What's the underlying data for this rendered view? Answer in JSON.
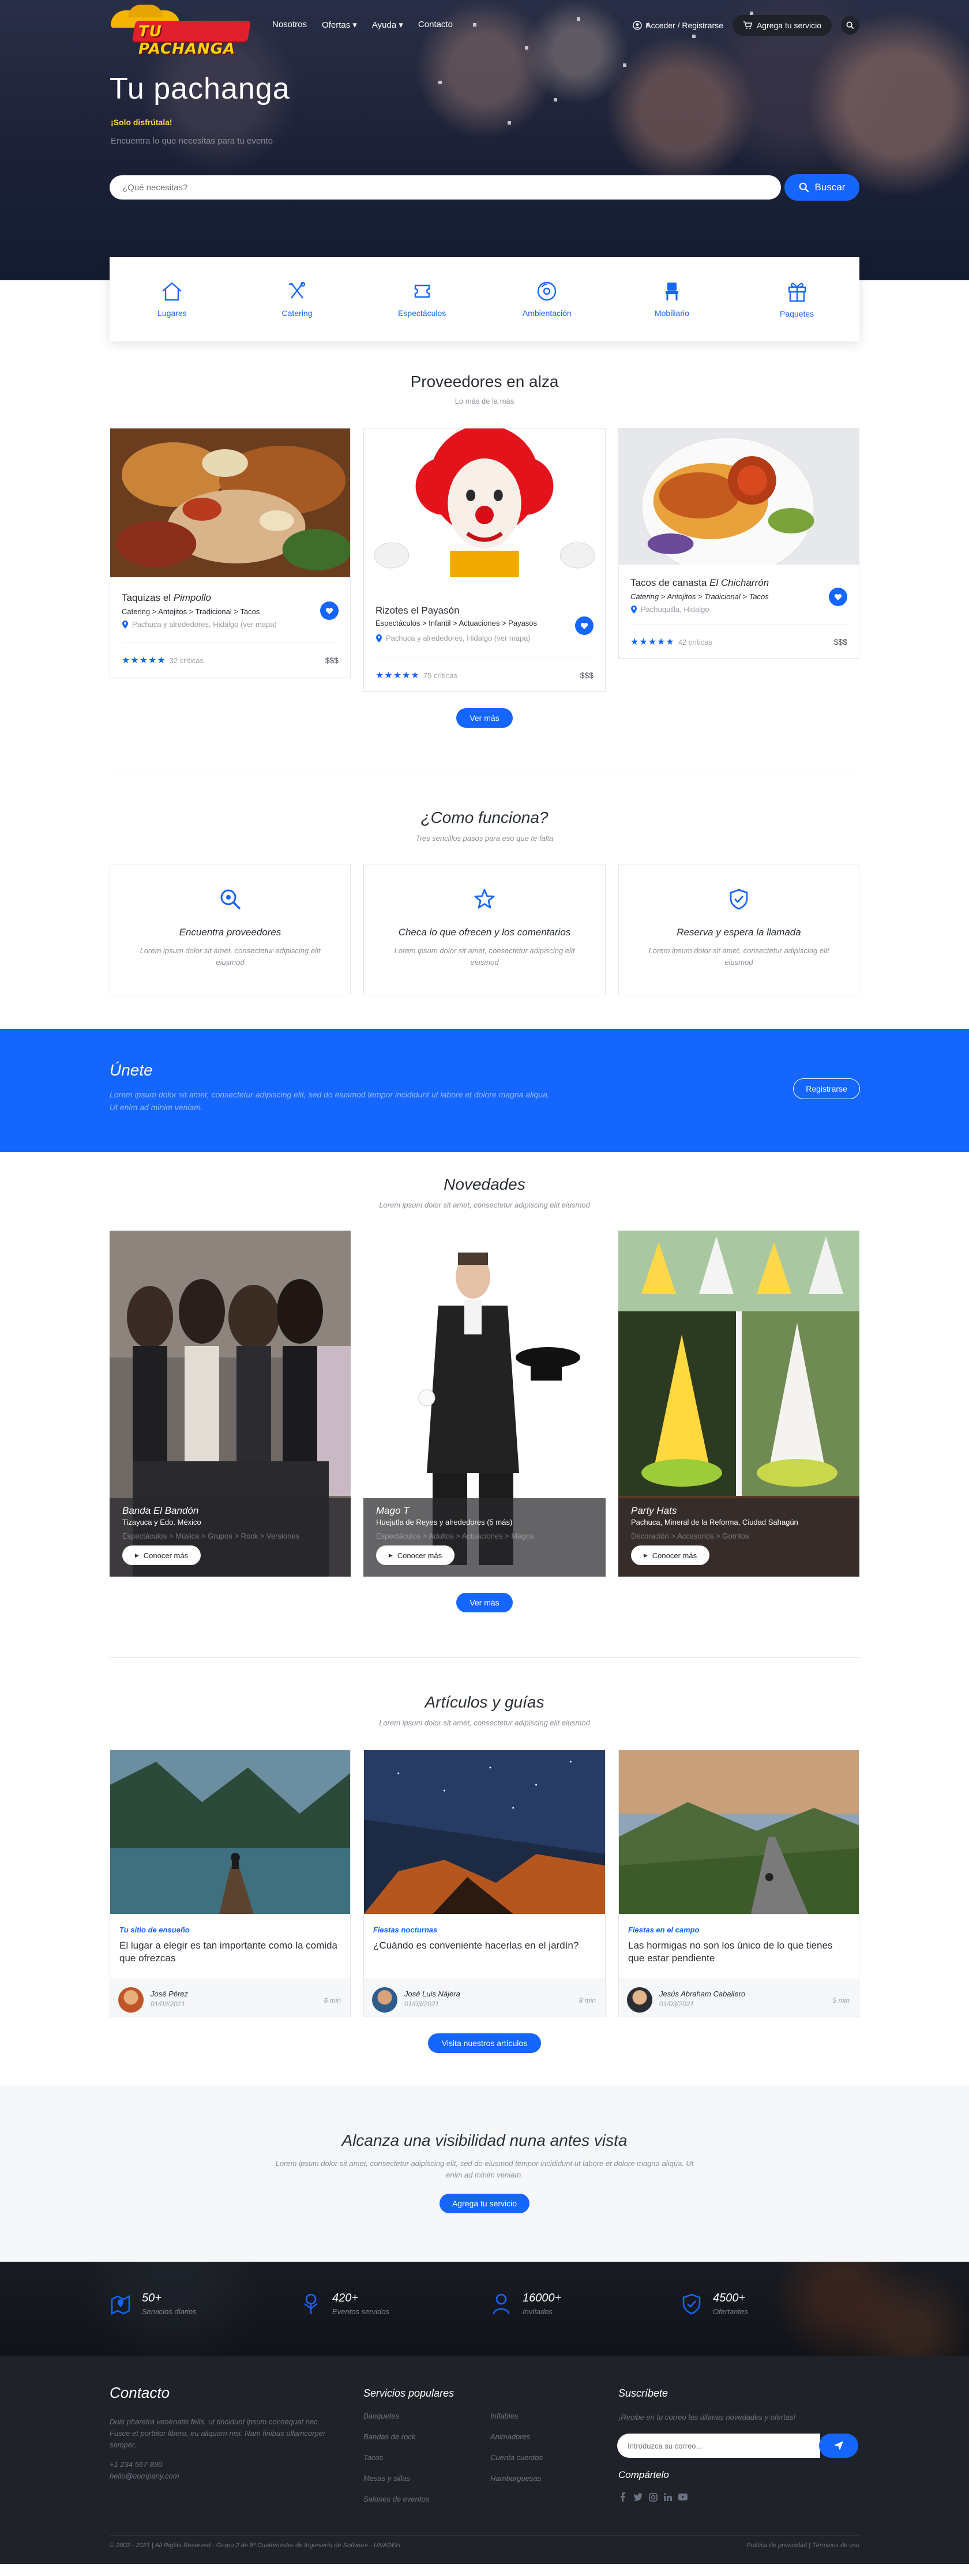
{
  "nav": {
    "brand": "TU PACHANGA",
    "links": [
      "Nosotros",
      "Ofertas ▾",
      "Ayuda ▾",
      "Contacto"
    ],
    "login": "Acceder / Registrarse",
    "add_service": "Agrega tu servicio"
  },
  "hero": {
    "title": "Tu pachanga",
    "tagline": "¡Solo disfrútala!",
    "subtitle": "Encuentra lo que necesitas para tu evento",
    "search_placeholder": "¿Qué necesitas?",
    "search_button": "Buscar"
  },
  "categories": [
    {
      "label": "Lugares",
      "icon": "house-icon"
    },
    {
      "label": "Catering",
      "icon": "utensils-icon"
    },
    {
      "label": "Espectáculos",
      "icon": "ticket-icon"
    },
    {
      "label": "Ambientación",
      "icon": "disc-icon"
    },
    {
      "label": "Mobiliario",
      "icon": "chair-icon"
    },
    {
      "label": "Paquetes",
      "icon": "gift-icon"
    }
  ],
  "trending": {
    "title": "Proveedores en alza",
    "subtitle": "Lo más de la más",
    "cards": [
      {
        "name_pre": "Taquizas el ",
        "name_em": "Pimpollo",
        "path": "Catering > Antojitos > Tradicional > Tacos",
        "location": "Pachuca y alrededores, Hidalgo (ver mapa)",
        "stars": "★★★★★",
        "reviews": "32 críticas",
        "price": "$$$"
      },
      {
        "name_pre": "Rizotes el Payasón",
        "name_em": "",
        "path": "Espectáculos > Infantil > Actuaciones > Payasos",
        "location": "Pachuca y alrededores, Hidalgo (ver mapa)",
        "stars": "★★★★★",
        "reviews": "75 críticas",
        "price": "$$$"
      },
      {
        "name_pre": "Tacos de canasta ",
        "name_em": "El Chicharrón",
        "path": "Catering > Antojitos > Tradicional > Tacos",
        "location": "Pachuquilla, Hidalgo",
        "stars": "★★★★★",
        "reviews": "42 críticas",
        "price": "$$$"
      }
    ],
    "more": "Ver más"
  },
  "how": {
    "title": "¿Como funciona?",
    "subtitle": "Tres sencillos pasos para eso que te falta",
    "steps": [
      {
        "title": "Encuentra proveedores",
        "text": "Lorem ipsum dolor sit amet, consectetur adipiscing elit eiusmod"
      },
      {
        "title": "Checa lo que ofrecen y los comentarios",
        "text": "Lorem ipsum dolor sit amet, consectetur adipiscing elit eiusmod"
      },
      {
        "title": "Reserva y espera la llamada",
        "text": "Lorem ipsum dolor sit amet, consectetur adipiscing elit eiusmod"
      }
    ]
  },
  "join": {
    "title": "Únete",
    "text": "Lorem ipsum dolor sit amet, consectetur adipiscing elit, sed do eiusmod tempor incididunt ut labore et dolore magna aliqua. Ut enim ad minim veniam.",
    "button": "Registrarse"
  },
  "news": {
    "title": "Novedades",
    "subtitle": "Lorem ipsum dolor sit amet, consectetur adipiscing elit eiusmod",
    "cards": [
      {
        "name": "Banda El Bandón",
        "location": "Tizayuca y Edo. México",
        "tags": "Espectáculos > Música > Grupos > Rock > Versiones",
        "button": "Conocer más"
      },
      {
        "name": "Mago T",
        "location": "Huejutla de Reyes y alrededores (5 más)",
        "tags": "Espectáculos > Adultos > Actuaciones > Magos",
        "button": "Conocer más"
      },
      {
        "name": "Party Hats",
        "location": "Pachuca, Mineral de la Reforma, Ciudad Sahagún",
        "tags": "Decoración > Accesorios > Gorritos",
        "button": "Conocer más"
      }
    ],
    "more": "Ver más"
  },
  "articles": {
    "title": "Artículos y guías",
    "subtitle": "Lorem ipsum dolor sit amet, consectetur adipiscing elit eiusmod",
    "cards": [
      {
        "tag": "Tu sitio de ensueño",
        "title": "El lugar a elegir es tan importante como la comida que ofrezcas",
        "author": "José Pérez",
        "date": "01/03/2021",
        "time": "6 min"
      },
      {
        "tag": "Fiestas nocturnas",
        "title": "¿Cuándo es conveniente hacerlas en el jardín?",
        "author": "José Luis Nájera",
        "date": "01/03/2021",
        "time": "8 min"
      },
      {
        "tag": "Fiestas en el campo",
        "title": "Las hormigas no son los único de lo que tienes que estar pendiente",
        "author": "Jesús Abraham Caballero",
        "date": "01/03/2021",
        "time": "5 min"
      }
    ],
    "button": "Visita nuestros artículos"
  },
  "visibility": {
    "title": "Alcanza una visibilidad nuna antes vista",
    "text": "Lorem ipsum dolor sit amet, consectetur adipiscing elit, sed do eiusmod tempor incididunt ut labore et dolore magna aliqua. Ut enim ad minim veniam.",
    "button": "Agrega tu servicio"
  },
  "stats": [
    {
      "num": "50+",
      "label": "Servicios diarios",
      "icon": "map-pin-icon"
    },
    {
      "num": "420+",
      "label": "Eventos servidos",
      "icon": "balloon-icon"
    },
    {
      "num": "16000+",
      "label": "Invitados",
      "icon": "user-icon"
    },
    {
      "num": "4500+",
      "label": "Ofertantes",
      "icon": "shield-icon"
    }
  ],
  "footer": {
    "contact_title": "Contacto",
    "contact_text": "Duis pharetra venenatis felis, ut tincidunt ipsum consequat nec. Fusce et porttitor libero, eu aliquam nisi. Nam finibus ullamcorper semper.",
    "phone": "+1 234 567-890",
    "email": "hello@company.com",
    "popular_title": "Servicios populares",
    "popular_col1": [
      "Banquetes",
      "Bandas de rock",
      "Tacos",
      "Mesas y sillas",
      "Salones de eventos"
    ],
    "popular_col2": [
      "Inflables",
      "Animadores",
      "Cuenta cuentos",
      "Hamburguesas"
    ],
    "subscribe_title": "Suscríbete",
    "subscribe_text": "¡Recibe en tu correo las últimas novedades y ofertas!",
    "subscribe_placeholder": "Introduzca su correo...",
    "share_title": "Compártelo",
    "copyright": "© 2002 - 2021 | All Rights Reserved - Grupo 2 de 8º Cuatrimestre de Ingeniería de Software - UNADEH",
    "legal": "Política de privacidad | Términos de uso"
  },
  "colors": {
    "accent": "#1565ff",
    "dark": "#1f2329",
    "yellow": "#ffd43b"
  }
}
